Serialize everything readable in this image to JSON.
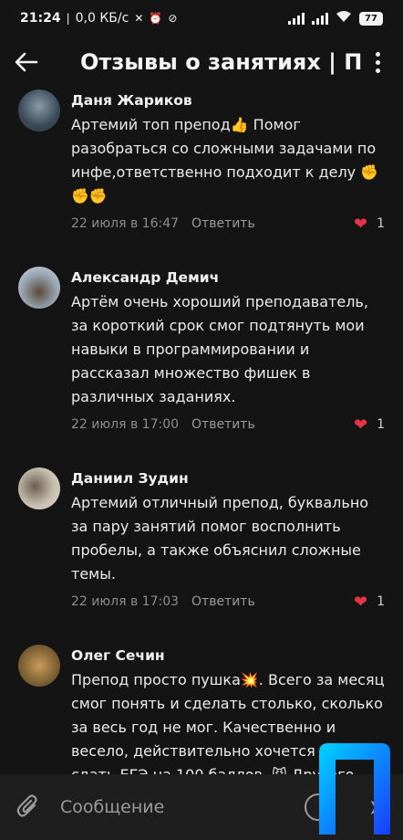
{
  "status": {
    "time": "21:24",
    "speed": "0,0 КБ/с",
    "battery": "77"
  },
  "header": {
    "title": "Отзывы о занятиях | П"
  },
  "comments": [
    {
      "author": "Даня Жариков",
      "text": "Артемий топ препод👍 Помог разобраться со сложными задачами по инфе,ответственно подходит к делу ✊✊✊",
      "time": "22 июля в 16:47",
      "reply": "Ответить",
      "likes": "1",
      "avatar_color": "#4a5a6a"
    },
    {
      "author": "Александр Демич",
      "text": "Артём очень хороший преподаватель, за короткий срок смог подтянуть мои навыки в программировании и рассказал множество фишек в различных заданиях.",
      "time": "22 июля в 17:00",
      "reply": "Ответить",
      "likes": "1",
      "avatar_color": "#7a8a9a"
    },
    {
      "author": "Даниил Зудин",
      "text": "Артемий отличный препод, буквально за пару занятий помог восполнить пробелы, а также объяснил сложные темы.",
      "time": "22 июля в 17:03",
      "reply": "Ответить",
      "likes": "1",
      "avatar_color": "#b0a898"
    },
    {
      "author": "Олег Сечин",
      "text": "Препод просто пушка💥. Всего за месяц смог понять и сделать столько, сколько за весь год не мог. Качественно и весело, действительно хочется взять и сдать ЕГЭ на 100 баллов. 😼 Другого такого преподавателя просто не найти",
      "time": "",
      "reply": "",
      "likes": "",
      "avatar_color": "#9a7a3a"
    }
  ],
  "composer": {
    "placeholder": "Сообщение"
  },
  "colors": {
    "background": "#141414",
    "heart": "#e8324a",
    "logo": "#1a6cff"
  }
}
